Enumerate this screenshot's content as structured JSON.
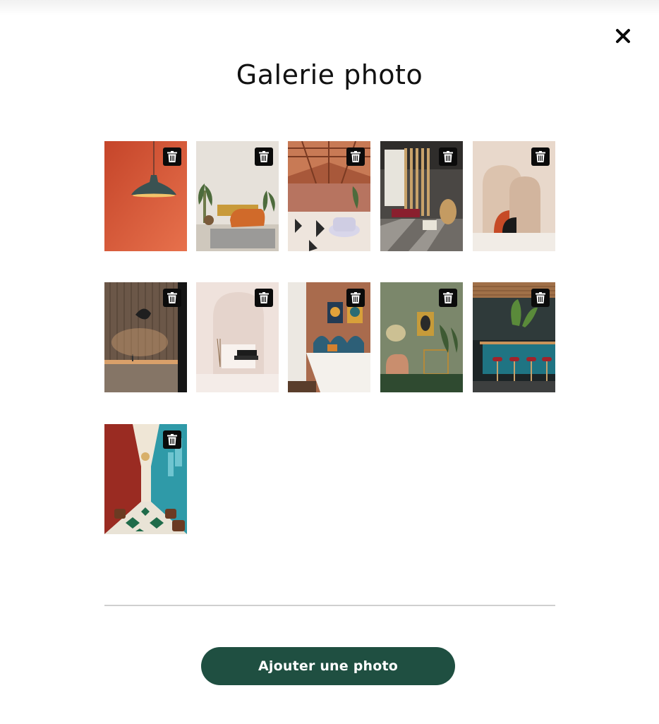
{
  "dialog": {
    "title": "Galerie photo",
    "close_icon": "close-icon",
    "add_button_label": "Ajouter une photo",
    "delete_icon": "trash-icon"
  },
  "colors": {
    "primary_button": "#1f4f41",
    "delete_badge": "#0b0b0b",
    "divider": "#cfcfcf"
  },
  "photos": [
    {
      "subject": "pendant-lamp-orange-wall"
    },
    {
      "subject": "living-room-orange-sofa"
    },
    {
      "subject": "greenhouse-restaurant"
    },
    {
      "subject": "lounge-wooden-screen"
    },
    {
      "subject": "beige-arches-decor"
    },
    {
      "subject": "wood-panel-kitchen"
    },
    {
      "subject": "white-arch-black-sofa"
    },
    {
      "subject": "bedroom-teal-headboard"
    },
    {
      "subject": "green-room-armchair"
    },
    {
      "subject": "bar-teal-counter"
    },
    {
      "subject": "long-dining-hall"
    }
  ]
}
